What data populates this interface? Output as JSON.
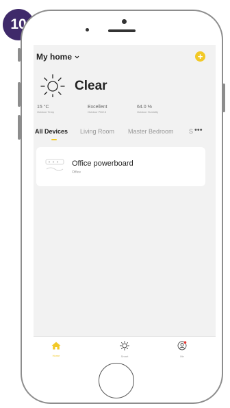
{
  "step_badge": "10",
  "header": {
    "home_title": "My home",
    "add_icon": "plus-icon"
  },
  "weather": {
    "icon": "sun-icon",
    "condition": "Clear",
    "stats": [
      {
        "value": "15 °C",
        "label": "Outdoor Temp"
      },
      {
        "value": "Excellent",
        "label": "Outdoor PM2.5"
      },
      {
        "value": "64.0 %",
        "label": "Outdoor Humidity"
      }
    ]
  },
  "tabs": [
    {
      "label": "All Devices",
      "active": true
    },
    {
      "label": "Living Room",
      "active": false
    },
    {
      "label": "Master Bedroom",
      "active": false
    },
    {
      "label": "S",
      "active": false
    }
  ],
  "more_icon": "ellipsis-icon",
  "devices": [
    {
      "name": "Office powerboard",
      "room": "Office",
      "icon": "powerboard-icon"
    }
  ],
  "bottom_nav": [
    {
      "label": "Home",
      "icon": "home-icon",
      "active": true
    },
    {
      "label": "Smart",
      "icon": "smart-sun-icon",
      "active": false
    },
    {
      "label": "Me",
      "icon": "user-icon",
      "active": false
    }
  ],
  "colors": {
    "accent": "#f2c927",
    "badge": "#3f2a6a",
    "notification": "#e53935"
  }
}
